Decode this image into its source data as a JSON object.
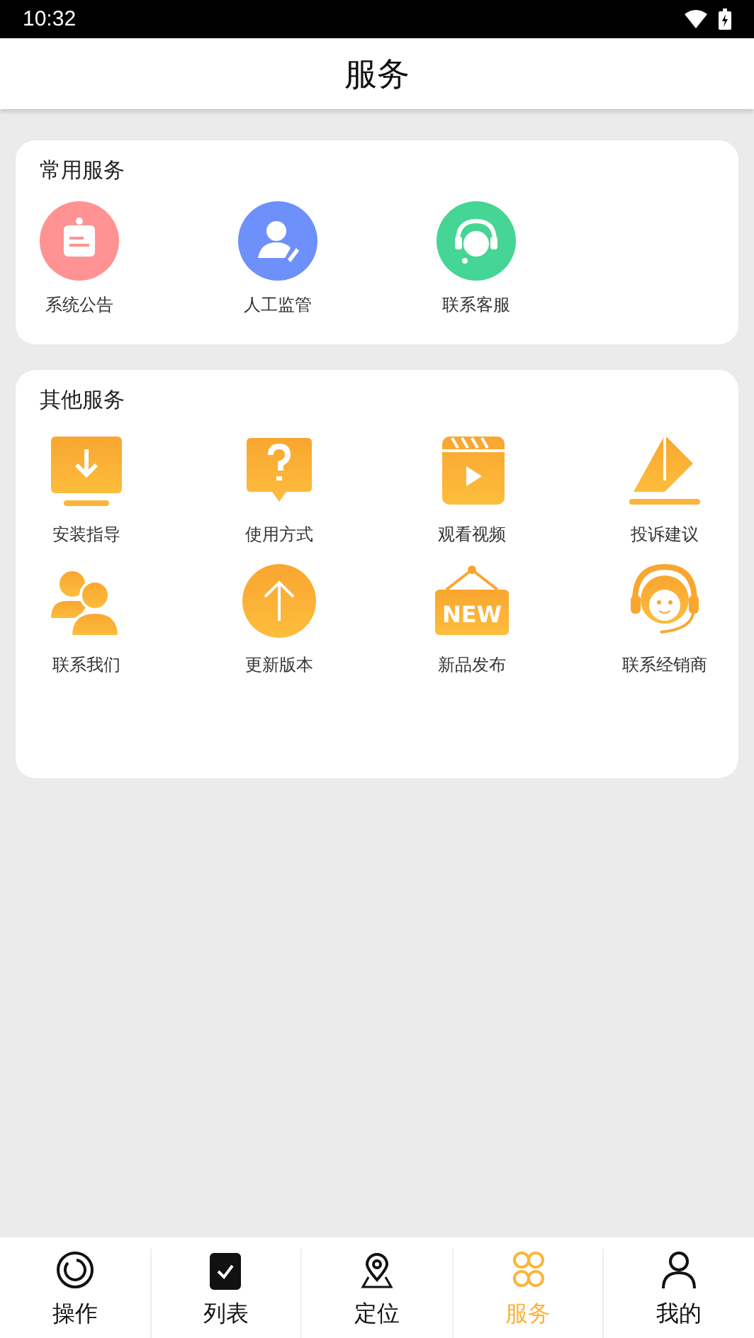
{
  "status_bar": {
    "time": "10:32"
  },
  "header": {
    "title": "服务"
  },
  "common_services": {
    "title": "常用服务",
    "items": [
      {
        "label": "系统公告",
        "color": "#ff9393"
      },
      {
        "label": "人工监管",
        "color": "#6e90fb"
      },
      {
        "label": "联系客服",
        "color": "#45d594"
      }
    ]
  },
  "other_services": {
    "title": "其他服务",
    "items": [
      {
        "label": "安装指导"
      },
      {
        "label": "使用方式"
      },
      {
        "label": "观看视频"
      },
      {
        "label": "投诉建议"
      },
      {
        "label": "联系我们"
      },
      {
        "label": "更新版本"
      },
      {
        "label": "新品发布",
        "icon_text": "NEW"
      },
      {
        "label": "联系经销商"
      }
    ]
  },
  "bottom_nav": [
    {
      "label": "操作",
      "selected": false
    },
    {
      "label": "列表",
      "selected": false
    },
    {
      "label": "定位",
      "selected": false
    },
    {
      "label": "服务",
      "selected": true
    },
    {
      "label": "我的",
      "selected": false
    }
  ]
}
